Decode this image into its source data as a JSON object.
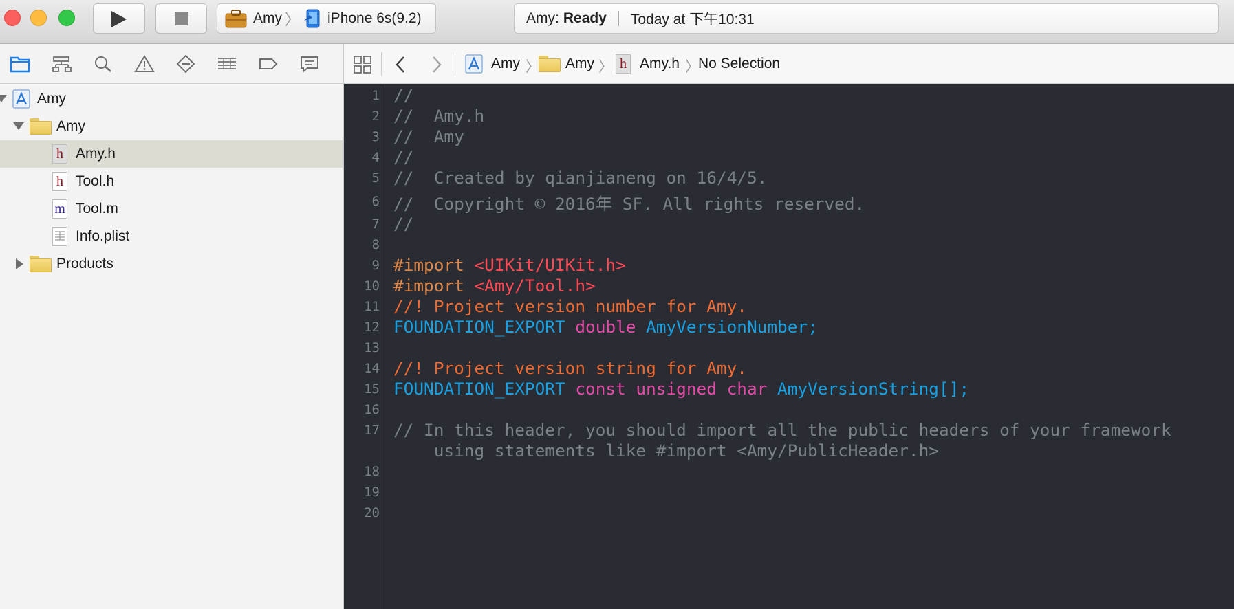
{
  "toolbar": {
    "scheme": {
      "target": "Amy",
      "device": "iPhone 6s(9.2)"
    },
    "activity": {
      "project": "Amy:",
      "status": "Ready",
      "time": "Today at 下午10:31"
    }
  },
  "navigator": {
    "tabs": [
      "project-navigator-icon",
      "symbol-navigator-icon",
      "find-navigator-icon",
      "issue-navigator-icon",
      "test-navigator-icon",
      "debug-navigator-icon",
      "breakpoint-navigator-icon",
      "report-navigator-icon"
    ],
    "tree": [
      {
        "label": "Amy",
        "kind": "project"
      },
      {
        "label": "Amy",
        "kind": "folder"
      },
      {
        "label": "Amy.h",
        "kind": "h",
        "selected": true
      },
      {
        "label": "Tool.h",
        "kind": "h"
      },
      {
        "label": "Tool.m",
        "kind": "m"
      },
      {
        "label": "Info.plist",
        "kind": "plist"
      },
      {
        "label": "Products",
        "kind": "folder"
      }
    ]
  },
  "jumpbar": {
    "project": "Amy",
    "group": "Amy",
    "file": "Amy.h",
    "selection": "No Selection"
  },
  "editor": {
    "line_numbers": [
      "1",
      "2",
      "3",
      "4",
      "5",
      "6",
      "7",
      "8",
      "9",
      "10",
      "11",
      "12",
      "13",
      "14",
      "15",
      "16",
      "17",
      "18",
      "19",
      "20"
    ],
    "lines": {
      "l1": "//",
      "l2": "//  Amy.h",
      "l3": "//  Amy",
      "l4": "//",
      "l5": "//  Created by qianjianeng on 16/4/5.",
      "l6": "//  Copyright © 2016年 SF. All rights reserved.",
      "l7": "//",
      "l9_pre": "#import ",
      "l9_str": "<UIKit/UIKit.h>",
      "l10_pre": "#import ",
      "l10_str": "<Amy/Tool.h>",
      "l11": "//! Project version number for Amy.",
      "l12_a": "FOUNDATION_EXPORT ",
      "l12_b": "double ",
      "l12_c": "AmyVersionNumber;",
      "l14": "//! Project version string for Amy.",
      "l15_a": "FOUNDATION_EXPORT ",
      "l15_b": "const unsigned char ",
      "l15_c": "AmyVersionString[];",
      "l17": "// In this header, you should import all the public headers of your framework",
      "l17b": "    using statements like #import <Amy/PublicHeader.h>"
    }
  },
  "colors": {
    "editor_bg": "#292c33",
    "comment": "#7b7f88",
    "preprocessor": "#e0894c",
    "string": "#ff4a55",
    "doc_comment": "#f06a33",
    "type": "#1a9fe0",
    "keyword": "#e34ba6",
    "selection": "#dcdcd2"
  }
}
